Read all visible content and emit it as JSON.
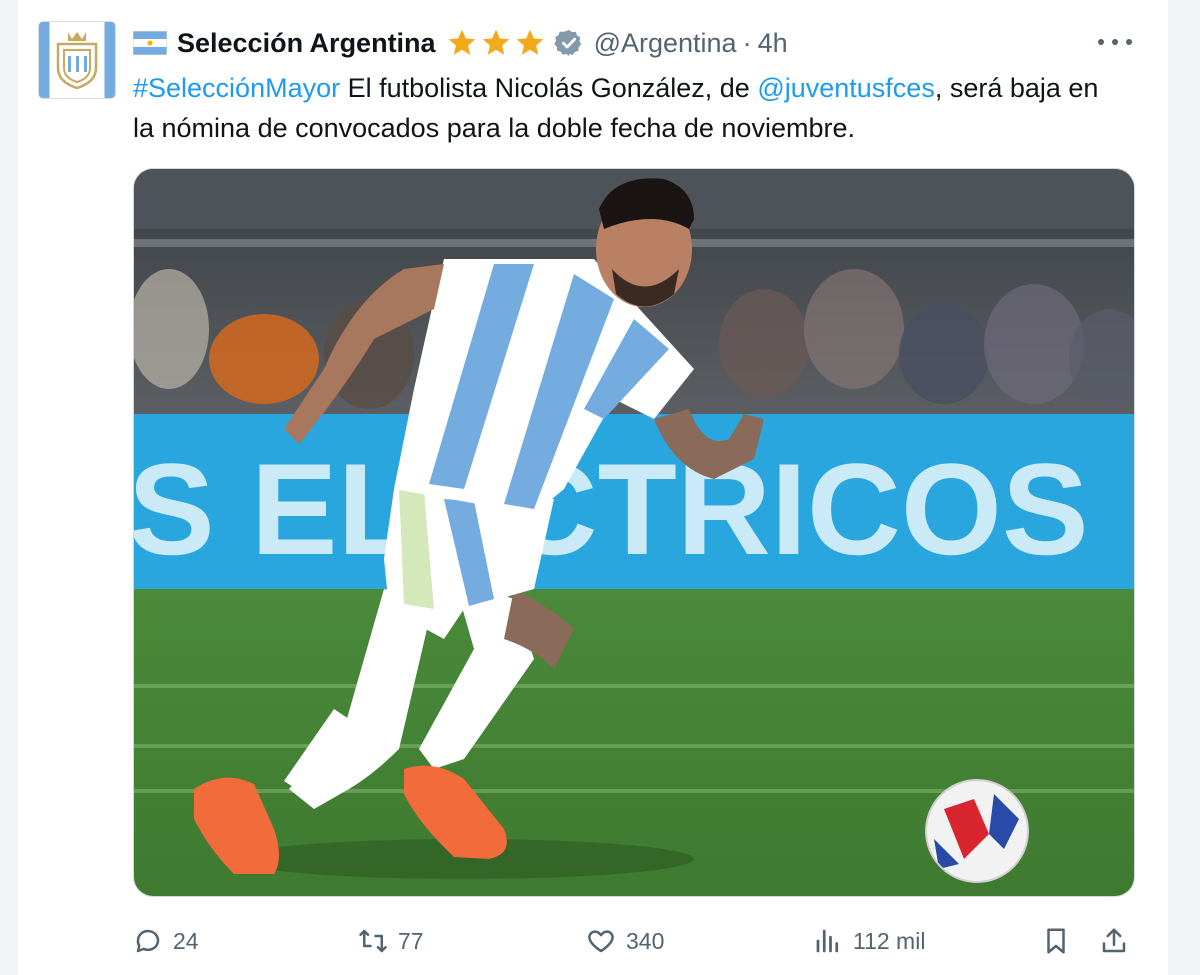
{
  "tweet": {
    "display_name": "Selección Argentina",
    "handle": "@Argentina",
    "separator": "·",
    "time": "4h",
    "text": {
      "hashtag": "#SelecciónMayor",
      "part1": " El futbolista Nicolás González, de ",
      "mention": "@juventusfces",
      "part2": ", será baja en la nómina de convocados para la doble fecha de noviembre."
    },
    "stars_count": 3,
    "icons": {
      "flag": "argentina-flag-icon",
      "star": "star-icon",
      "verified": "verified-badge-icon",
      "more": "more-options-icon"
    },
    "media": {
      "banner_text": "S ELECTRICOS",
      "description_hidden": false
    }
  },
  "actions": {
    "replies": "24",
    "retweets": "77",
    "likes": "340",
    "views": "112 mil"
  },
  "colors": {
    "link": "#1d9bf0",
    "secondary_text": "#536471",
    "star": "#f4a91b",
    "verified": "#829aab",
    "argentina_blue": "#74acdf"
  }
}
